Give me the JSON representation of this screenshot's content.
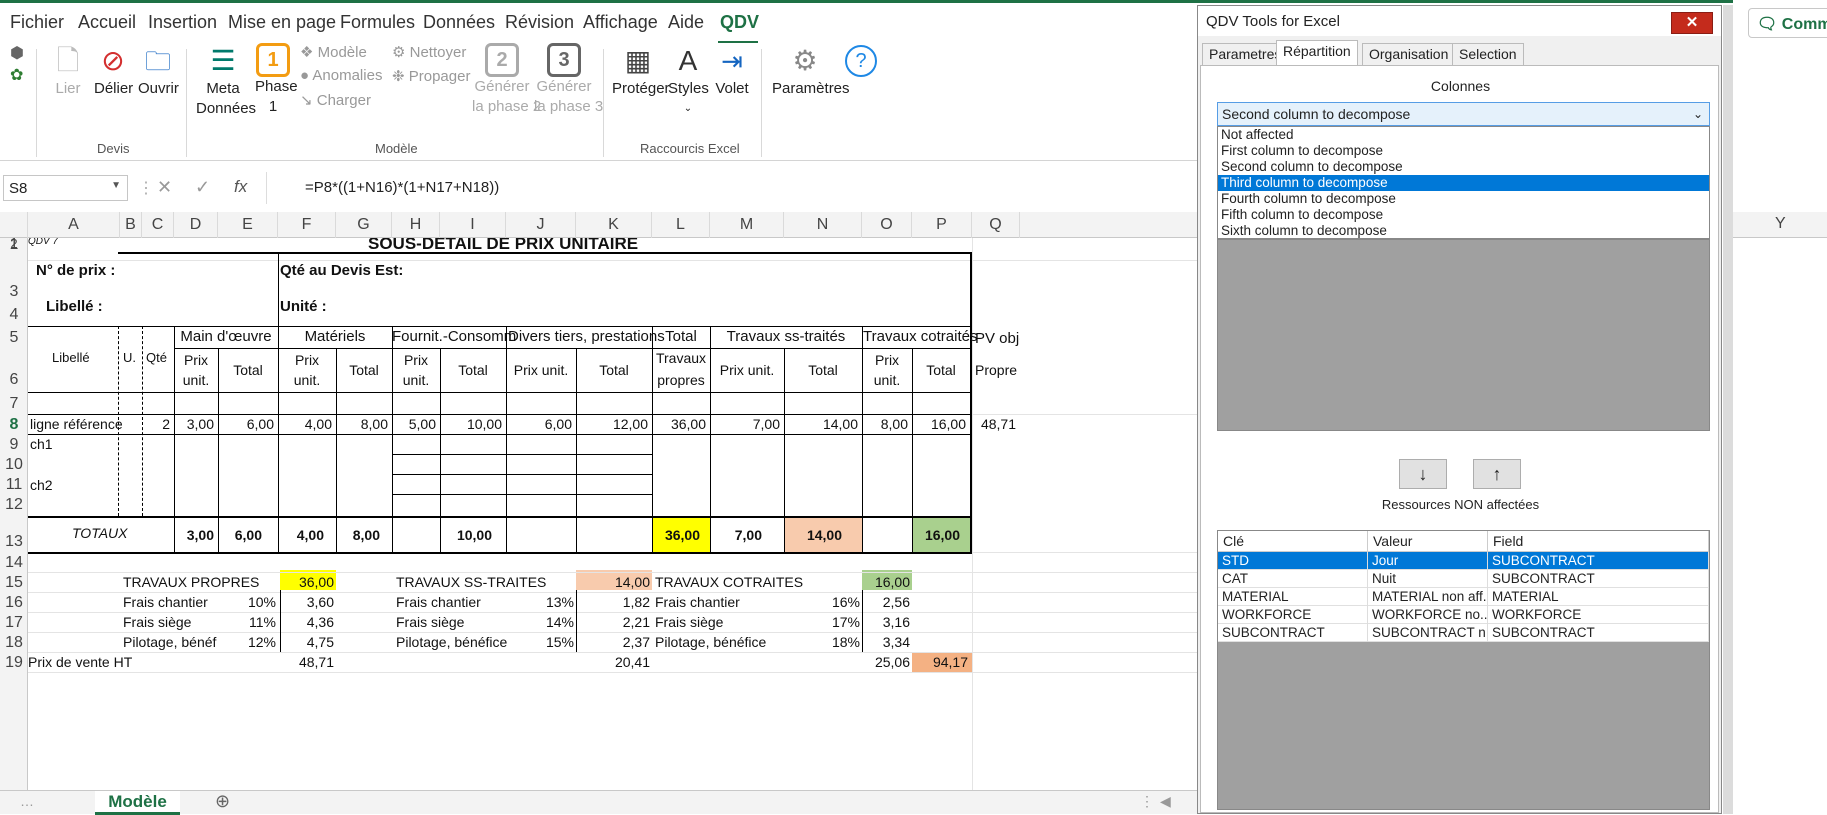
{
  "tabs": [
    "Fichier",
    "Accueil",
    "Insertion",
    "Mise en page",
    "Formules",
    "Données",
    "Révision",
    "Affichage",
    "Aide",
    "QDV"
  ],
  "ribbon": {
    "devis": {
      "lier": "Lier",
      "delier": "Délier",
      "ouvrir": "Ouvrir",
      "group": "Devis"
    },
    "modele": {
      "meta1": "Meta",
      "meta2": "Données",
      "phase1a": "Phase",
      "phase1b": "1",
      "phase1num": "1",
      "modele": "Modèle",
      "anomalies": "Anomalies",
      "charger": "Charger",
      "nettoyer": "Nettoyer",
      "propager": "Propager",
      "gen2a": "Générer",
      "gen2b": "la phase 2",
      "gen2num": "2",
      "gen3a": "Générer",
      "gen3b": "la phase 3",
      "gen3num": "3",
      "group": "Modèle"
    },
    "raccourcis": {
      "proteger": "Protéger",
      "styles": "Styles",
      "volet": "Volet",
      "group": "Raccourcis Excel"
    },
    "parametres": "Paramètres"
  },
  "formula_bar": {
    "namebox": "S8",
    "formula": "=P8*((1+N16)*(1+N17+N18))"
  },
  "columns": [
    "A",
    "B",
    "C",
    "D",
    "E",
    "F",
    "G",
    "H",
    "I",
    "J",
    "K",
    "L",
    "M",
    "N",
    "O",
    "P",
    "Q"
  ],
  "rows": [
    "1",
    "2",
    "3",
    "4",
    "5",
    "6",
    "7",
    "8",
    "9",
    "10",
    "11",
    "12",
    "13",
    "14",
    "15",
    "16",
    "17",
    "18",
    "19"
  ],
  "sheet": {
    "title": "SOUS-DETAIL DE PRIX UNITAIRE",
    "qdv": "QDV 7",
    "no_prix": "N° de prix :",
    "qte_devis": "Qté au Devis Est:",
    "libelle_label": "Libellé :",
    "unite": "Unité :",
    "h_libelle": "Libellé",
    "h_u": "U.",
    "h_qte": "Qté",
    "h_main": "Main d'œuvre",
    "h_mat": "Matériels",
    "h_fourn": "Fournit.-Consomm",
    "h_divers": "Divers tiers, prestations",
    "h_total1": "Total",
    "h_travaux_ss": "Travaux ss-traités",
    "h_travaux_cot": "Travaux cotraités",
    "h_pv": "PV objec",
    "h_prix": "Prix",
    "h_unit": "unit.",
    "h_total": "Total",
    "h_prixunit": "Prix unit.",
    "h_travaux": "Travaux",
    "h_propres": "propres",
    "h_propre": "Propre",
    "r8": [
      "ligne référence",
      "2",
      "3,00",
      "6,00",
      "4,00",
      "8,00",
      "5,00",
      "10,00",
      "6,00",
      "12,00",
      "36,00",
      "7,00",
      "14,00",
      "8,00",
      "16,00",
      "48,71"
    ],
    "ch1": "ch1",
    "ch2": "ch2",
    "totaux": "TOTAUX",
    "r13": [
      "3,00",
      "6,00",
      "4,00",
      "8,00",
      "10,00",
      "36,00",
      "7,00",
      "14,00",
      "16,00"
    ],
    "s15": {
      "a": "TRAVAUX PROPRES",
      "av": "36,00",
      "b": "TRAVAUX SS-TRAITES",
      "bv": "14,00",
      "c": "TRAVAUX COTRAITES",
      "cv": "16,00"
    },
    "s16": {
      "a": "Frais chantier",
      "ap": "10%",
      "av": "3,60",
      "b": "Frais chantier",
      "bp": "13%",
      "bv": "1,82",
      "c": "Frais chantier",
      "cp": "16%",
      "cv": "2,56"
    },
    "s17": {
      "a": "Frais siège",
      "ap": "11%",
      "av": "4,36",
      "b": "Frais siège",
      "bp": "14%",
      "bv": "2,21",
      "c": "Frais siège",
      "cp": "17%",
      "cv": "3,16"
    },
    "s18": {
      "a": "Pilotage, bénéf",
      "ap": "12%",
      "av": "4,75",
      "b": "Pilotage, bénéfice",
      "bp": "15%",
      "bv": "2,37",
      "c": "Pilotage, bénéfice",
      "cp": "18%",
      "cv": "3,34"
    },
    "s19": {
      "a": "Prix de vente HT",
      "av": "48,71",
      "bv": "20,41",
      "cv": "25,06",
      "total": "94,17"
    },
    "sheet_tab": "Modèle"
  },
  "panel": {
    "title": "QDV Tools for Excel",
    "close": "✕",
    "tabs": [
      "Parametres",
      "Répartition",
      "Organisation",
      "Selection"
    ],
    "colonnes": "Colonnes",
    "combo_value": "Second column to decompose",
    "options": [
      "Not affected",
      "First column to decompose",
      "Second column to decompose",
      "Third column to decompose",
      "Fourth column to decompose",
      "Fifth column to decompose",
      "Sixth column to decompose"
    ],
    "selected_option": 3,
    "down": "↓",
    "up": "↑",
    "ressources": "Ressources NON affectées",
    "list_headers": [
      "Clé",
      "Valeur",
      "Field"
    ],
    "list_rows": [
      [
        "STD",
        "Jour",
        "SUBCONTRACT"
      ],
      [
        "CAT",
        "Nuit",
        "SUBCONTRACT"
      ],
      [
        "MATERIAL",
        "MATERIAL non aff...",
        "MATERIAL"
      ],
      [
        "WORKFORCE",
        "WORKFORCE no...",
        "WORKFORCE"
      ],
      [
        "SUBCONTRACT",
        "SUBCONTRACT n...",
        "SUBCONTRACT"
      ]
    ]
  },
  "right": {
    "comments": "Comm",
    "col_y": "Y"
  },
  "colors": {
    "accent": "#1e7145",
    "yellow": "#ffff00",
    "peach": "#f8cbad",
    "green": "#a9d08e",
    "orange": "#f4b183",
    "select": "#0078d7"
  }
}
